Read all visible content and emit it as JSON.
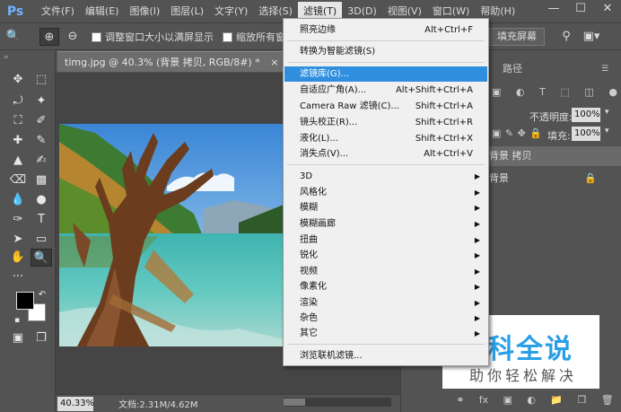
{
  "app": {
    "logo": "Ps"
  },
  "menubar": {
    "items": [
      "文件(F)",
      "编辑(E)",
      "图像(I)",
      "图层(L)",
      "文字(Y)",
      "选择(S)",
      "滤镜(T)",
      "3D(D)",
      "视图(V)",
      "窗口(W)",
      "帮助(H)"
    ],
    "active_index": 6
  },
  "window_controls": {
    "minimize": "—",
    "maximize": "☐",
    "close": "✕"
  },
  "options_bar": {
    "resize_label": "调整窗口大小以满屏显示",
    "zoom_all_label": "缩放所有窗",
    "fill_screen_label": "填充屏幕"
  },
  "document": {
    "tab_title": "timg.jpg @ 40.3% (背景 拷贝, RGB/8#) *",
    "close": "×",
    "zoom": "40.33%",
    "info": "文档:2.31M/4.62M"
  },
  "filter_menu": {
    "items": [
      {
        "label": "照亮边缘",
        "shortcut": "Alt+Ctrl+F"
      },
      {
        "label": "转换为智能滤镜(S)",
        "shortcut": ""
      },
      {
        "label": "滤镜库(G)...",
        "shortcut": "",
        "highlighted": true
      },
      {
        "label": "自适应广角(A)...",
        "shortcut": "Alt+Shift+Ctrl+A"
      },
      {
        "label": "Camera Raw 滤镜(C)...",
        "shortcut": "Shift+Ctrl+A"
      },
      {
        "label": "镜头校正(R)...",
        "shortcut": "Shift+Ctrl+R"
      },
      {
        "label": "液化(L)...",
        "shortcut": "Shift+Ctrl+X"
      },
      {
        "label": "消失点(V)...",
        "shortcut": "Alt+Ctrl+V"
      },
      {
        "label": "3D",
        "submenu": true
      },
      {
        "label": "风格化",
        "submenu": true
      },
      {
        "label": "模糊",
        "submenu": true
      },
      {
        "label": "模糊画廊",
        "submenu": true
      },
      {
        "label": "扭曲",
        "submenu": true
      },
      {
        "label": "锐化",
        "submenu": true
      },
      {
        "label": "视频",
        "submenu": true
      },
      {
        "label": "像素化",
        "submenu": true
      },
      {
        "label": "渲染",
        "submenu": true
      },
      {
        "label": "杂色",
        "submenu": true
      },
      {
        "label": "其它",
        "submenu": true
      },
      {
        "label": "浏览联机滤镜...",
        "shortcut": ""
      }
    ]
  },
  "right_panel": {
    "tab_paths": "路径",
    "opacity_label": "不透明度:",
    "opacity_value": "100%",
    "fill_label": "填充:",
    "fill_value": "100%",
    "layers": [
      {
        "name": "背景 拷贝",
        "selected": true
      },
      {
        "name": "背景",
        "selected": false,
        "locked": true
      }
    ],
    "bottom_icons": [
      "link-icon",
      "fx-icon",
      "mask-icon",
      "adjustment-icon",
      "group-icon",
      "new-layer-icon",
      "trash-icon"
    ],
    "fx_label": "fx"
  },
  "watermark": {
    "title": "百科全说",
    "subtitle": "助你轻松解决"
  },
  "colors": {
    "highlight": "#2f8fde",
    "ui_bg": "#535353",
    "menu_bg": "#f0f0f0",
    "watermark_blue": "#2b9fe6"
  }
}
